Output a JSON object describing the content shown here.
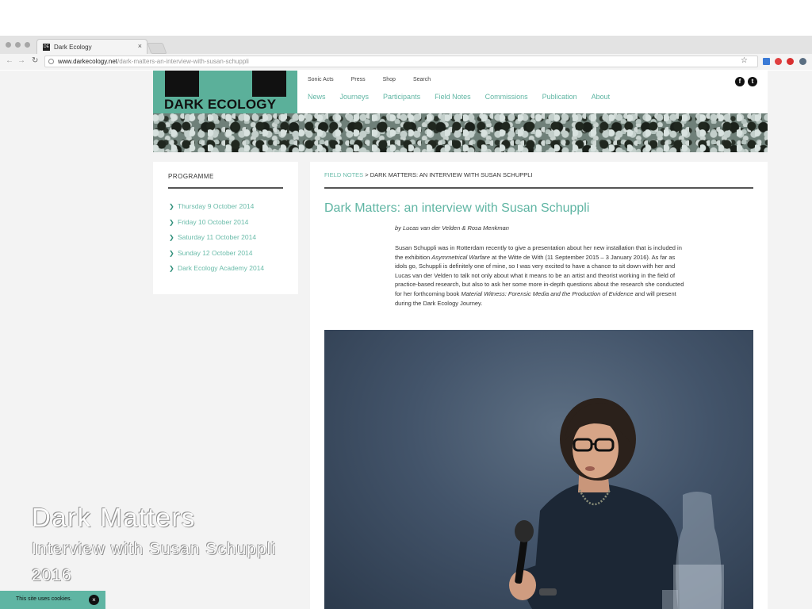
{
  "browser": {
    "tab_title": "Dark Ecology",
    "tab_close": "×",
    "url_host": "www.darkecology.net",
    "url_path": "/dark-matters-an-interview-with-susan-schuppli"
  },
  "header": {
    "logo_text": "DARK ECOLOGY",
    "top_nav": [
      "Sonic Acts",
      "Press",
      "Shop",
      "Search"
    ],
    "main_nav": [
      "News",
      "Journeys",
      "Participants",
      "Field Notes",
      "Commissions",
      "Publication",
      "About"
    ],
    "social": [
      "f",
      "t"
    ]
  },
  "sidebar": {
    "title": "PROGRAMME",
    "items": [
      "Thursday 9 October 2014",
      "Friday 10 October 2014",
      "Saturday 11 October 2014",
      "Sunday 12 October 2014",
      "Dark Ecology Academy 2014"
    ]
  },
  "article": {
    "breadcrumb_section": "FIELD NOTES",
    "breadcrumb_sep": " > ",
    "breadcrumb_current": "DARK MATTERS: AN INTERVIEW WITH SUSAN SCHUPPLI",
    "title": "Dark Matters: an interview with Susan Schuppli",
    "byline": "by Lucas van der Velden & Rosa Menkman",
    "body": {
      "p1": "Susan Schuppli was in Rotterdam recently to give a presentation about her new installation that is included in the exhibition ",
      "em1": "Asymmetrical Warfare",
      "p2": " at the Witte de With (11 September 2015 – 3 January 2016). As far as idols go, Schuppli is definitely one of mine, so I was very excited to have a chance to sit down with her and Lucas van der Velden to talk not only about what it means to be an artist and theorist working in the field of practice-based research, but also to ask her some more in-depth questions about the research she conducted for her forthcoming book ",
      "em2": "Material Witness: Forensic Media and the Production of Evidence",
      "p3": " and will present during the Dark Ecology Journey."
    }
  },
  "overlay": {
    "line1": "Dark Matters",
    "line2": "Interview with Susan Schuppli",
    "line3": "2016"
  },
  "cookie": {
    "text": "This site uses cookies.",
    "close": "×"
  }
}
